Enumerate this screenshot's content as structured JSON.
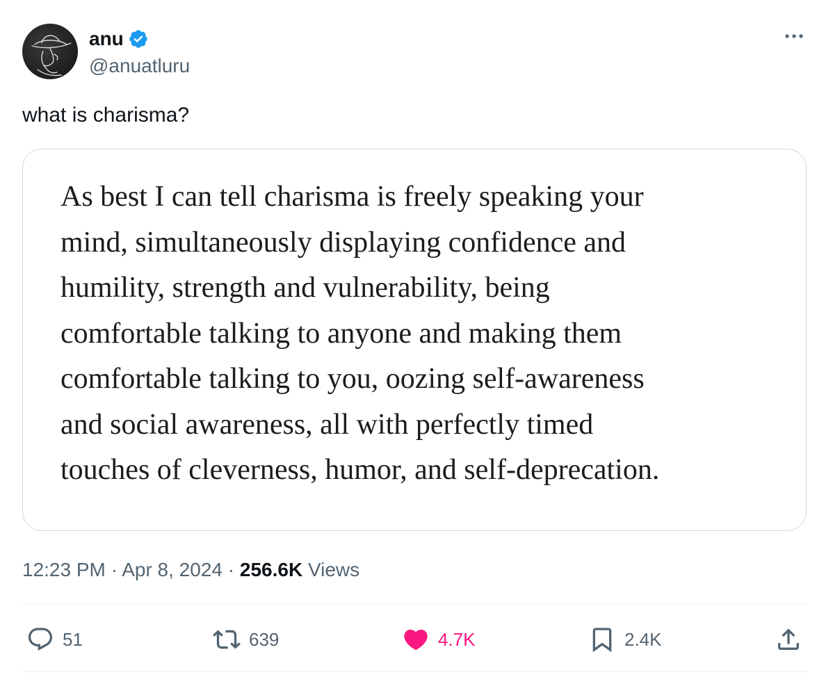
{
  "author": {
    "display_name": "anu",
    "handle": "@anuatluru",
    "verified": true,
    "avatar_icon": "avatar-cowboy-sketch"
  },
  "tweet": {
    "text": "what is charisma?",
    "quote_lines": [
      "As best I can tell charisma is freely speaking your",
      "mind, simultaneously displaying confidence and",
      "humility, strength and vulnerability, being",
      "comfortable talking to anyone and making them",
      "comfortable talking to you, oozing self-awareness",
      "and social awareness, all with perfectly timed",
      "touches of cleverness, humor, and self-deprecation."
    ]
  },
  "meta": {
    "time": "12:23 PM",
    "separator": " · ",
    "date": "Apr 8, 2024",
    "views_count": "256.6K",
    "views_label": " Views"
  },
  "actions": {
    "replies": "51",
    "reposts": "639",
    "likes": "4.7K",
    "bookmarks": "2.4K"
  },
  "colors": {
    "verified_blue": "#1d9bf0",
    "like_pink": "#f91880",
    "secondary_text": "#536471",
    "primary_text": "#0f1419",
    "border": "#cfd9de"
  }
}
